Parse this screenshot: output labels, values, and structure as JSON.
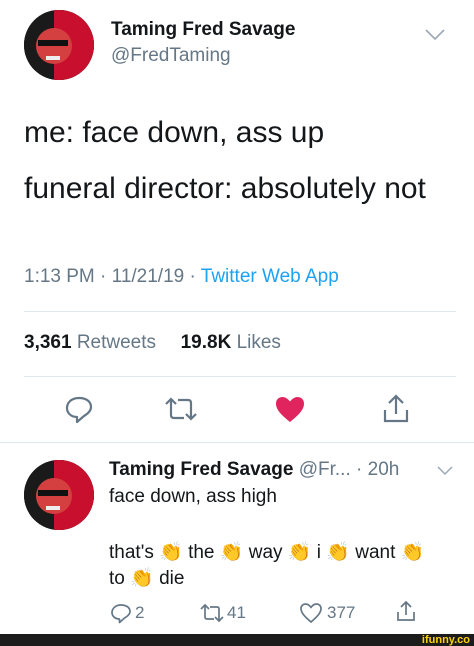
{
  "main_tweet": {
    "author_name": "Taming Fred Savage",
    "author_handle": "@FredTaming",
    "line1": "me: face down, ass up",
    "line2": "funeral director: absolutely not",
    "time": "1:13 PM",
    "date": "11/21/19",
    "separator": "·",
    "source": "Twitter Web App",
    "retweets_count": "3,361",
    "retweets_label": "Retweets",
    "likes_count": "19.8K",
    "likes_label": "Likes",
    "actions": [
      "reply-icon",
      "retweet-icon",
      "heart-icon-filled",
      "share-icon"
    ],
    "like_color": "#e0245e"
  },
  "reply_tweet": {
    "author_name": "Taming Fred Savage",
    "author_handle": "@Fr...",
    "time_ago": "· 20h",
    "line1": "face down, ass high",
    "line2_words": [
      "that's",
      "the",
      "way",
      "i",
      "want"
    ],
    "line3_words": [
      "to",
      "die"
    ],
    "clap": "👏",
    "reply_count": "2",
    "retweet_count": "41",
    "like_count": "377"
  },
  "watermark": "ifunny.co",
  "colors": {
    "accent": "#1da1f2",
    "text": "#14171a",
    "muted": "#657786",
    "divider": "#e1e8ed"
  }
}
